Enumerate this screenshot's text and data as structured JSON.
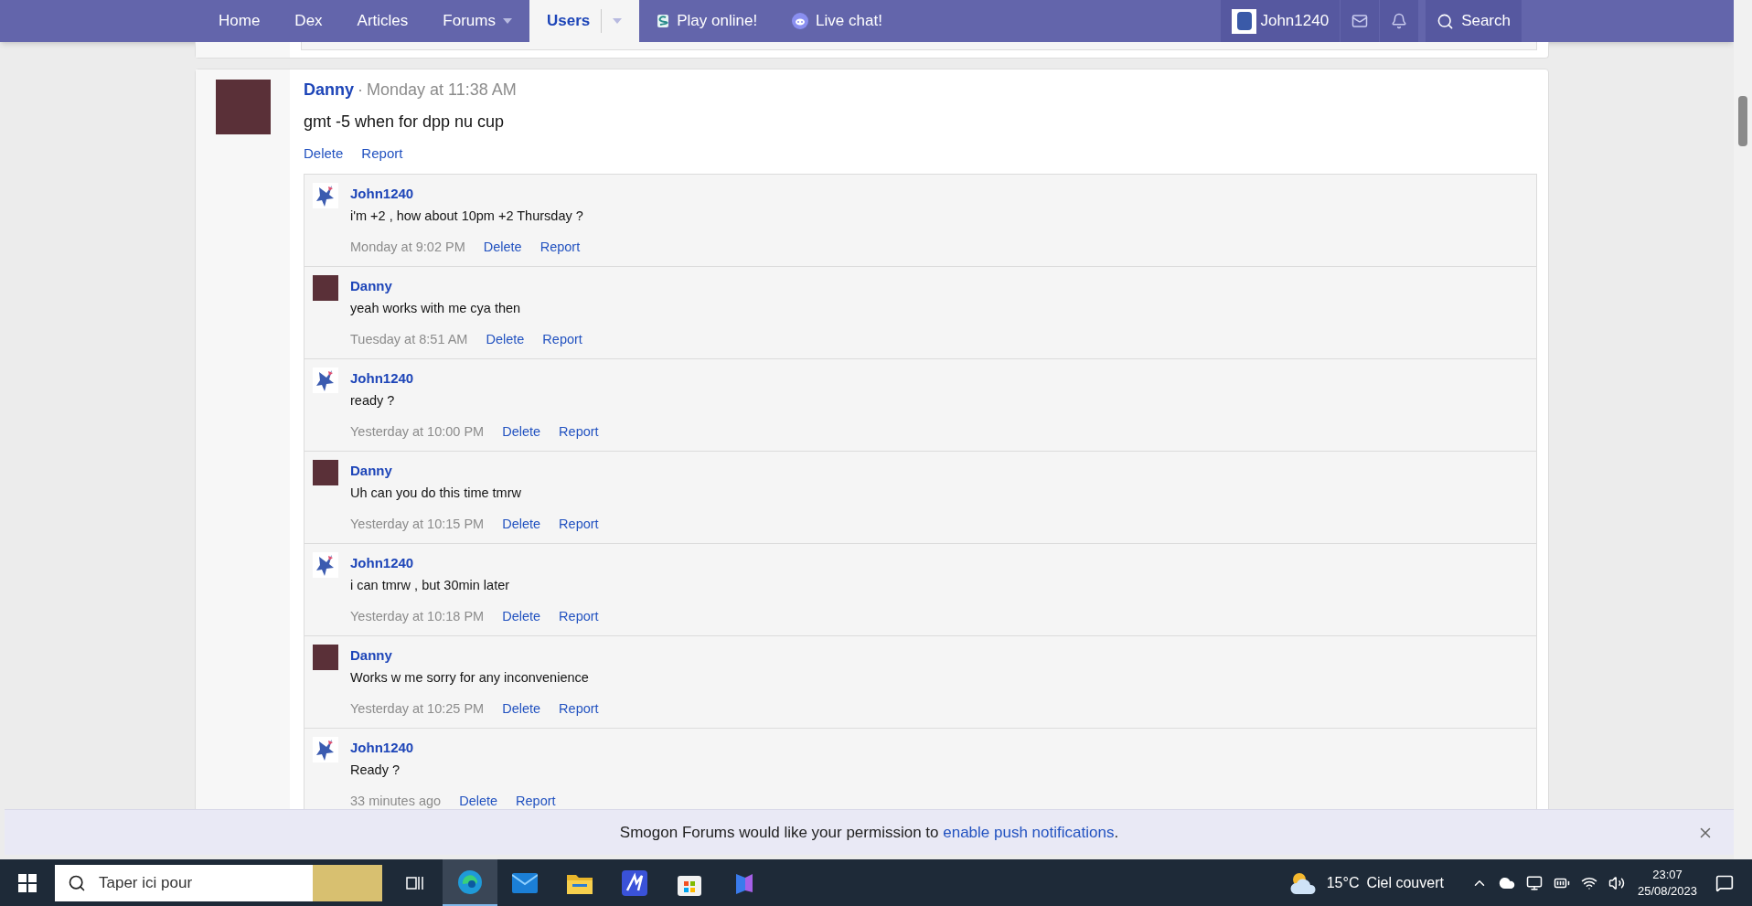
{
  "nav": {
    "items": [
      {
        "kind": "plain",
        "label": "Home",
        "selected": false,
        "dropdown": false
      },
      {
        "kind": "plain",
        "label": "Dex",
        "selected": false,
        "dropdown": false
      },
      {
        "kind": "plain",
        "label": "Articles",
        "selected": false,
        "dropdown": false
      },
      {
        "kind": "plain",
        "label": "Forums",
        "selected": false,
        "dropdown": true
      },
      {
        "kind": "plain",
        "label": "Users",
        "selected": true,
        "dropdown": true
      },
      {
        "kind": "game",
        "label": "Play online!",
        "selected": false,
        "dropdown": false
      },
      {
        "kind": "chat",
        "label": "Live chat!",
        "selected": false,
        "dropdown": false
      }
    ],
    "user": "John1240",
    "search": "Search"
  },
  "post": {
    "author": "Danny",
    "separator": "·",
    "time": "Monday at 11:38 AM",
    "text": "gmt -5 when for dpp nu cup",
    "actions": [
      "Delete",
      "Report"
    ],
    "comments": [
      {
        "kind": "sprite",
        "author": "John1240",
        "text": "i'm +2 , how about 10pm +2 Thursday ?",
        "time": "Monday at 9:02 PM",
        "actions": [
          "Delete",
          "Report"
        ]
      },
      {
        "kind": "photo",
        "author": "Danny",
        "text": "yeah works with me cya then",
        "time": "Tuesday at 8:51 AM",
        "actions": [
          "Delete",
          "Report"
        ]
      },
      {
        "kind": "sprite",
        "author": "John1240",
        "text": "ready ?",
        "time": "Yesterday at 10:00 PM",
        "actions": [
          "Delete",
          "Report"
        ]
      },
      {
        "kind": "photo",
        "author": "Danny",
        "text": "Uh can you do this time tmrw",
        "time": "Yesterday at 10:15 PM",
        "actions": [
          "Delete",
          "Report"
        ]
      },
      {
        "kind": "sprite",
        "author": "John1240",
        "text": "i can tmrw , but 30min later",
        "time": "Yesterday at 10:18 PM",
        "actions": [
          "Delete",
          "Report"
        ]
      },
      {
        "kind": "photo",
        "author": "Danny",
        "text": "Works w me sorry for any inconvenience",
        "time": "Yesterday at 10:25 PM",
        "actions": [
          "Delete",
          "Report"
        ]
      },
      {
        "kind": "sprite",
        "author": "John1240",
        "text": "Ready ?",
        "time": "33 minutes ago",
        "actions": [
          "Delete",
          "Report"
        ]
      }
    ]
  },
  "notice": {
    "text": "Smogon Forums would like your permission to",
    "link": "enable push notifications",
    "end": "."
  },
  "taskbar": {
    "search_placeholder": "Taper ici pour",
    "apps": [
      {
        "kind": "taskview",
        "selected": false
      },
      {
        "kind": "edge",
        "selected": true
      },
      {
        "kind": "mail",
        "selected": false
      },
      {
        "kind": "folder",
        "selected": false
      },
      {
        "kind": "app",
        "selected": false
      },
      {
        "kind": "store",
        "selected": false
      },
      {
        "kind": "copilot",
        "selected": false
      }
    ],
    "temperature": "15°C",
    "weather": "Ciel couvert",
    "time": "23:07",
    "date": "25/08/2023"
  }
}
